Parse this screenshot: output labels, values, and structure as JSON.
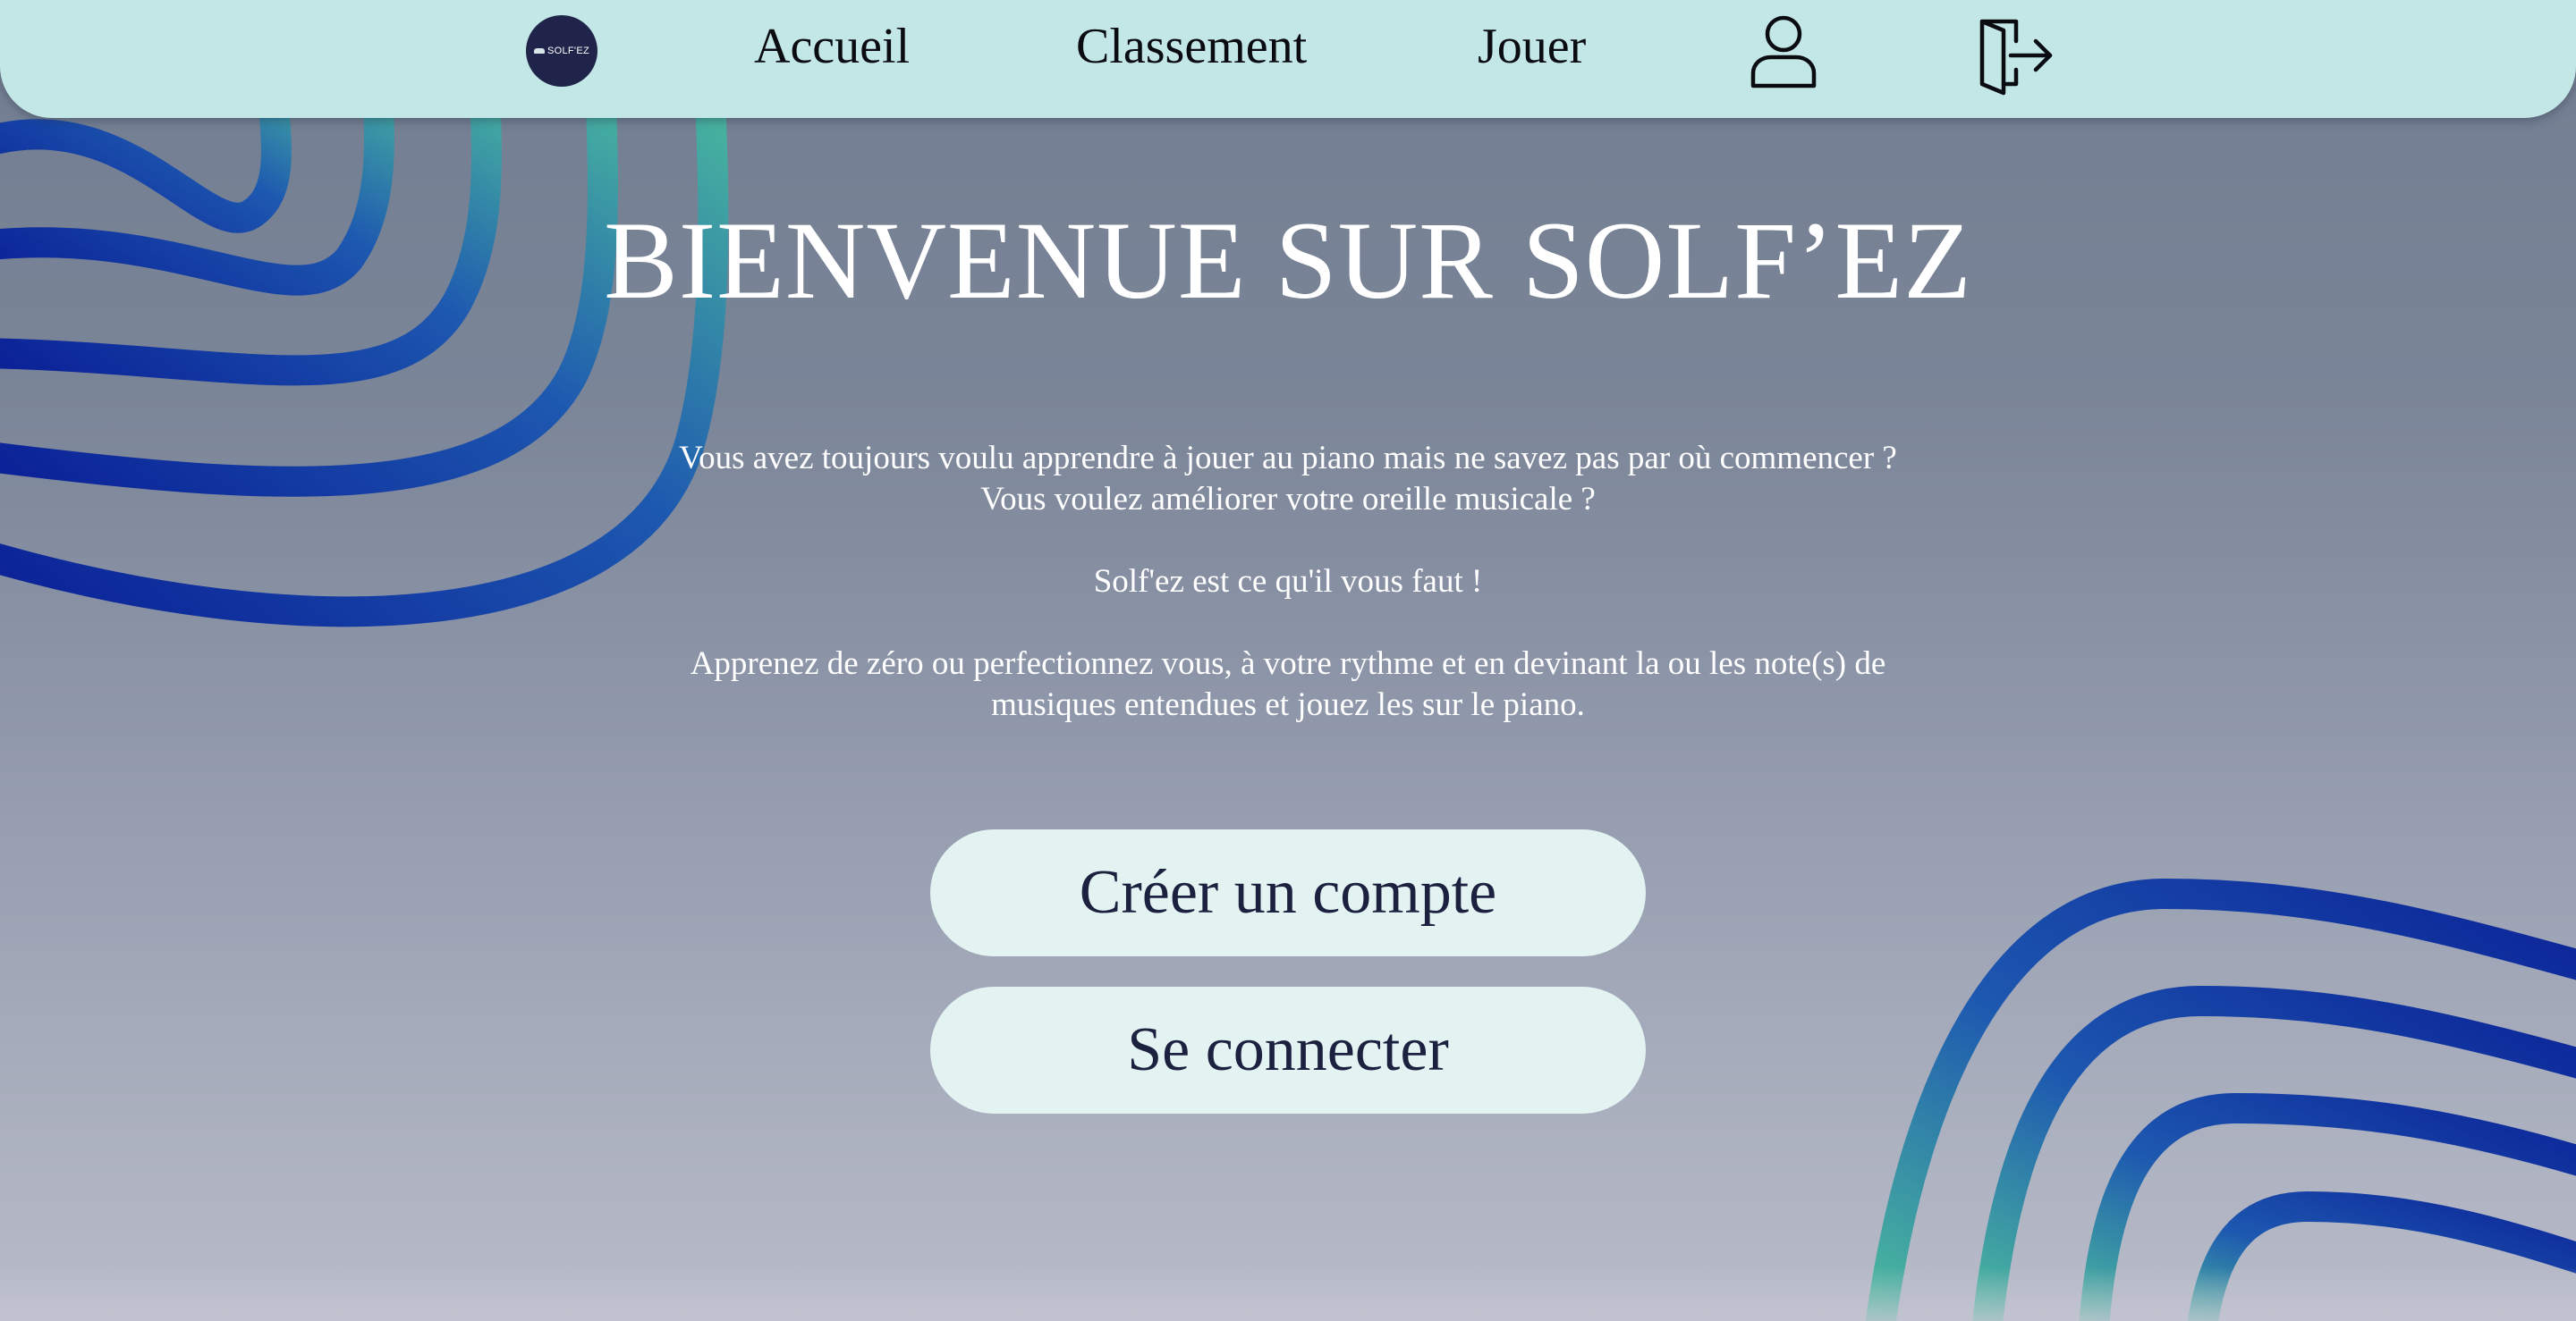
{
  "navbar": {
    "logo_text": "SOLF'EZ",
    "links": [
      "Accueil",
      "Classement",
      "Jouer"
    ],
    "icons": [
      "user-icon",
      "logout-icon"
    ]
  },
  "hero": {
    "title": "BIENVENUE SUR SOLF’EZ",
    "line1": "Vous avez toujours voulu apprendre à jouer au piano mais ne savez pas par où commencer ?",
    "line2": "Vous voulez améliorer votre oreille musicale ?",
    "line3": "Solf'ez est ce qu'il vous faut !",
    "line4": "Apprenez de zéro ou perfectionnez vous, à votre rythme et en devinant la ou les note(s) de",
    "line5": "musiques entendues et jouez les sur le piano."
  },
  "buttons": {
    "register": "Créer un compte",
    "login": "Se connecter"
  },
  "colors": {
    "navbar_bg": "#c2e7e6",
    "button_bg": "#e3f3f2",
    "button_text": "#1c2140",
    "swirl_dark": "#0a1f96",
    "swirl_light": "#4fc39c"
  }
}
